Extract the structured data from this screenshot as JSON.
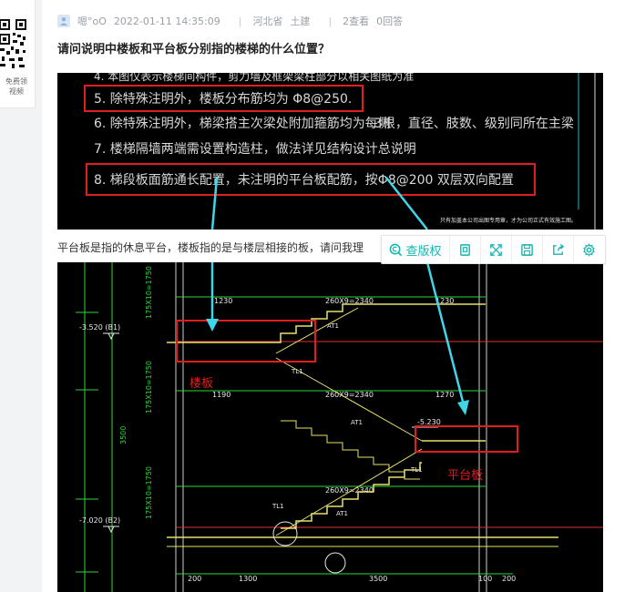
{
  "sidebar": {
    "qr_caption_line1": "免费领",
    "qr_caption_line2": "视频"
  },
  "question": {
    "user": "嗯°oO",
    "datetime": "2022-01-11 14:35:09",
    "location": "河北省",
    "category": "土建",
    "views": "2查看",
    "answers": "0回答",
    "title": "请问说明中楼板和平台板分别指的楼梯的什么位置？",
    "body": "平台板是指的休息平台，楼板指的是与楼层相接的板，请问我理"
  },
  "image1": {
    "line4": "4. 本图仅表示楼梯间构件，剪力墙及框架梁柱部分以相关图纸为准",
    "line5": "5. 除特殊注明外，楼板分布筋均为  Φ8@250.",
    "line6": "6. 除特殊注明外，梯梁搭主次梁处附加箍筋均为每侧",
    "line6b": "3根，直径、肢数、级别同所在主梁",
    "line7": "7. 楼梯隔墙两端需设置构造柱，做法详见结构设计总说明",
    "line8": "8. 梯段板面筋通长配置，未注明的平台板配筋，按Φ8@200 双层双向配置",
    "footer": "只有加盖本公司出图专用章，才为公司正式有效施工图。"
  },
  "image2": {
    "label_louban": "楼板",
    "label_pingtaiban": "平台板",
    "elev_b1": "-3.520 (B1)",
    "elev_b2": "-7.020 (B2)",
    "elev_mid": "-5.230",
    "dim_1230_a": "1230",
    "dim_2340_a": "260X9=2340",
    "dim_1230_b": "1230",
    "dim_1190": "1190",
    "dim_2340_b": "260X9=2340",
    "dim_1270": "1270",
    "dim_2340_c": "260X9=2340",
    "dim_200_a": "200",
    "dim_1300": "1300",
    "dim_3500_bottom": "3500",
    "dim_100": "100",
    "dim_200_b": "200",
    "dim_3500_side": "3500",
    "side_dim_1": "175X10=1750",
    "side_dim_2": "175X10=1750",
    "side_dim_3": "175X10=1750",
    "at1_a": "AT1",
    "at1_b": "AT1",
    "at1_c": "AT1",
    "tl1_a": "TL1",
    "tl1_b": "TL1",
    "tl1_c": "TL1"
  },
  "toolbar": {
    "check_label": "查版权"
  }
}
